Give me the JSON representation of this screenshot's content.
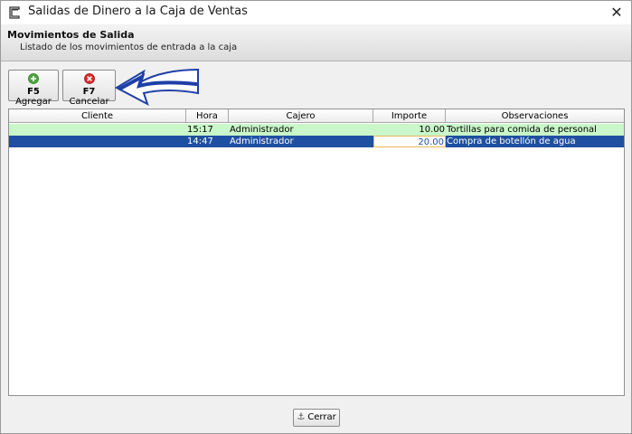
{
  "window": {
    "title": "Salidas de Dinero a la Caja de Ventas",
    "close_glyph": "✕"
  },
  "header": {
    "title": "Movimientos de Salida",
    "subtitle": "Listado de los movimientos de entrada a la caja"
  },
  "toolbar": {
    "agregar": {
      "key": "F5",
      "label": "Agregar",
      "icon": "add-icon",
      "color": "#49a83c"
    },
    "cancelar": {
      "key": "F7",
      "label": "Cancelar",
      "icon": "cancel-icon",
      "color": "#d92b2b"
    }
  },
  "annotation": {
    "arrow_color": "#1f3fa8"
  },
  "grid": {
    "columns": [
      "Cliente",
      "Hora",
      "Cajero",
      "Importe",
      "Observaciones"
    ],
    "rows": [
      [
        "",
        "15:17",
        "Administrador",
        "10.00",
        "Tortillas para comida de personal"
      ],
      [
        "",
        "14:47",
        "Administrador",
        "20.00",
        "Compra de botellón de agua"
      ]
    ],
    "selected_row_index": 1,
    "colors": {
      "row_highlight": "#c9f7c9",
      "row_selected": "#1f4fa0"
    }
  },
  "footer": {
    "cerrar_label": "Cerrar",
    "icon": "anchor-icon"
  }
}
